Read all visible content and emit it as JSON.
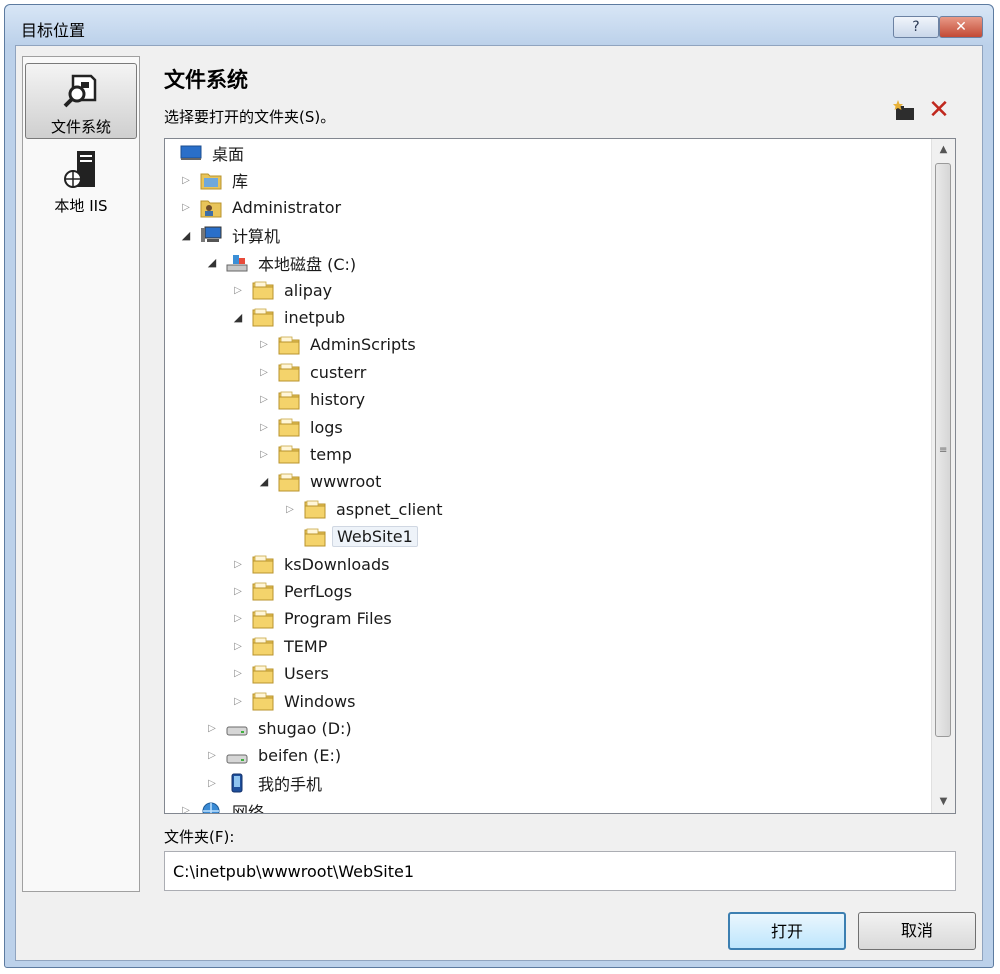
{
  "window": {
    "title": "目标位置",
    "help_glyph": "?",
    "close_glyph": "✕"
  },
  "sidebar": {
    "items": [
      {
        "label": "文件系统",
        "icon": "file-system-icon",
        "selected": true
      },
      {
        "label": "本地 IIS",
        "icon": "server-icon",
        "selected": false
      }
    ]
  },
  "main": {
    "title": "文件系统",
    "prompt": "选择要打开的文件夹(S)。",
    "toolbar": {
      "new_folder_icon": "new-folder-icon",
      "delete_icon": "delete-icon",
      "delete_glyph": "✕"
    }
  },
  "tree": {
    "nodes": [
      {
        "label": "桌面",
        "icon": "desktop",
        "expander": "none",
        "depth": 0
      },
      {
        "label": "库",
        "icon": "library",
        "expander": "collapsed",
        "depth": 1
      },
      {
        "label": "Administrator",
        "icon": "user-folder",
        "expander": "collapsed",
        "depth": 1
      },
      {
        "label": "计算机",
        "icon": "computer",
        "expander": "expanded",
        "depth": 1
      },
      {
        "label": "本地磁盘 (C:)",
        "icon": "system-drive",
        "expander": "expanded",
        "depth": 2
      },
      {
        "label": "alipay",
        "icon": "folder",
        "expander": "collapsed",
        "depth": 3
      },
      {
        "label": "inetpub",
        "icon": "folder",
        "expander": "expanded",
        "depth": 3
      },
      {
        "label": "AdminScripts",
        "icon": "folder",
        "expander": "collapsed",
        "depth": 4
      },
      {
        "label": "custerr",
        "icon": "folder",
        "expander": "collapsed",
        "depth": 4
      },
      {
        "label": "history",
        "icon": "folder",
        "expander": "collapsed",
        "depth": 4
      },
      {
        "label": "logs",
        "icon": "folder",
        "expander": "collapsed",
        "depth": 4
      },
      {
        "label": "temp",
        "icon": "folder",
        "expander": "collapsed",
        "depth": 4
      },
      {
        "label": "wwwroot",
        "icon": "folder",
        "expander": "expanded",
        "depth": 4
      },
      {
        "label": "aspnet_client",
        "icon": "folder",
        "expander": "collapsed",
        "depth": 5
      },
      {
        "label": "WebSite1",
        "icon": "folder",
        "expander": "none",
        "depth": 5,
        "selected": true
      },
      {
        "label": "ksDownloads",
        "icon": "folder",
        "expander": "collapsed",
        "depth": 3
      },
      {
        "label": "PerfLogs",
        "icon": "folder",
        "expander": "collapsed",
        "depth": 3
      },
      {
        "label": "Program Files",
        "icon": "folder",
        "expander": "collapsed",
        "depth": 3
      },
      {
        "label": "TEMP",
        "icon": "folder",
        "expander": "collapsed",
        "depth": 3
      },
      {
        "label": "Users",
        "icon": "folder",
        "expander": "collapsed",
        "depth": 3
      },
      {
        "label": "Windows",
        "icon": "folder",
        "expander": "collapsed",
        "depth": 3
      },
      {
        "label": "shugao (D:)",
        "icon": "drive",
        "expander": "collapsed",
        "depth": 2
      },
      {
        "label": "beifen (E:)",
        "icon": "drive",
        "expander": "collapsed",
        "depth": 2
      },
      {
        "label": "我的手机",
        "icon": "phone",
        "expander": "collapsed",
        "depth": 2
      },
      {
        "label": "网络",
        "icon": "network",
        "expander": "collapsed",
        "depth": 1
      }
    ],
    "scroll": {
      "up_glyph": "▲",
      "down_glyph": "▼",
      "grip_glyph": "≡"
    }
  },
  "folder_field": {
    "label": "文件夹(F):",
    "value": "C:\\inetpub\\wwwroot\\WebSite1"
  },
  "buttons": {
    "open": "打开",
    "cancel": "取消"
  }
}
